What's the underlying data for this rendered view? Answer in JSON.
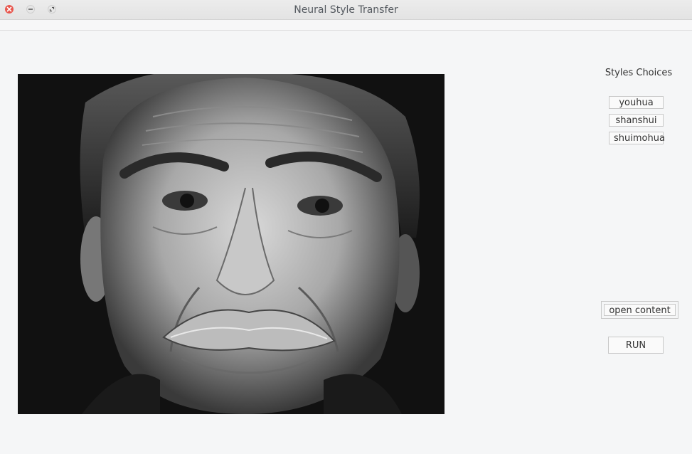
{
  "window": {
    "title": "Neural Style Transfer"
  },
  "sidebar": {
    "styles_title": "Styles Choices",
    "style_buttons": [
      {
        "label": "youhua"
      },
      {
        "label": "shanshui"
      },
      {
        "label": "shuimohua"
      }
    ],
    "open_content_label": "open content",
    "run_label": "RUN"
  },
  "content_image": {
    "subject": "black-and-white portrait of an elderly man with a grey mustache",
    "colors": {
      "background": "#111111",
      "skin": "#bdbdbd"
    }
  },
  "colors": {
    "close_button": "#e8574e",
    "window_background": "#f5f6f7"
  }
}
